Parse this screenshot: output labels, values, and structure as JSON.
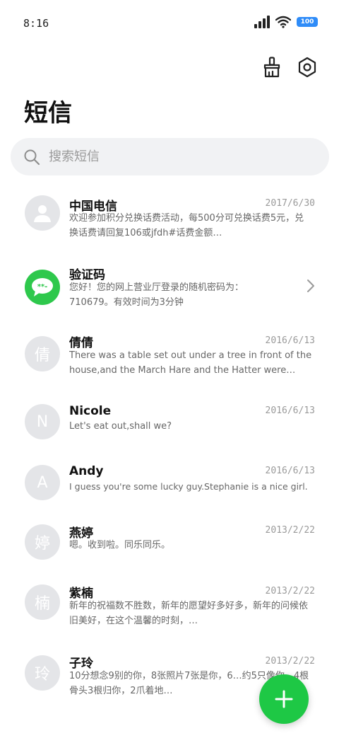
{
  "status_bar": {
    "time": "8:16",
    "battery": "100",
    "icons": [
      "signal-icon",
      "wifi-icon",
      "battery-icon"
    ]
  },
  "header": {
    "title": "短信",
    "actions": [
      "clean-brush-icon",
      "settings-hexagon-icon"
    ]
  },
  "search": {
    "placeholder": "搜索短信"
  },
  "conversations": [
    {
      "name": "中国电信",
      "date": "2017/6/30",
      "preview": "欢迎参加积分兑换话费活动，每500分可兑换话费5元，兑换话费请回复106或jfdh#话费金额…",
      "avatar": "person-icon"
    },
    {
      "name": "验证码",
      "date": "",
      "preview": "您好！您的网上营业厅登录的随机密码为：710679。有效时间为3分钟",
      "avatar": "message-bubble-icon"
    },
    {
      "name": "倩倩",
      "date": "2016/6/13",
      "preview": "There was a table set out under a tree in front of the house,and the March Hare and the Hatter were having …",
      "avatar_text": "倩"
    },
    {
      "name": "Nicole",
      "date": "2016/6/13",
      "preview": "Let's eat out,shall we?",
      "avatar_text": "N"
    },
    {
      "name": "Andy",
      "date": "2016/6/13",
      "preview": "I guess you're some lucky guy.Stephanie is a nice girl.",
      "avatar_text": "A"
    },
    {
      "name": "燕婷",
      "date": "2013/2/22",
      "preview": "嗯。收到啦。同乐同乐。",
      "avatar_text": "婷"
    },
    {
      "name": "紫楠",
      "date": "2013/2/22",
      "preview": "新年的祝福数不胜数，新年的愿望好多好多，新年的问候依旧美好，在这个温馨的时刻，…",
      "avatar_text": "楠"
    },
    {
      "name": "子玲",
      "date": "2013/2/22",
      "preview": "10分想念9别的你，8张照片7张是你，6…约5只像你，4根骨头3根归你，2爪着地…",
      "avatar_text": "玲"
    }
  ],
  "fab": {
    "icon": "plus-icon"
  },
  "colors": {
    "accent": "#1ec845",
    "avatar_grey": "#e4e5e8",
    "battery": "#2f8cf8",
    "search_bg": "#f1f2f4"
  }
}
